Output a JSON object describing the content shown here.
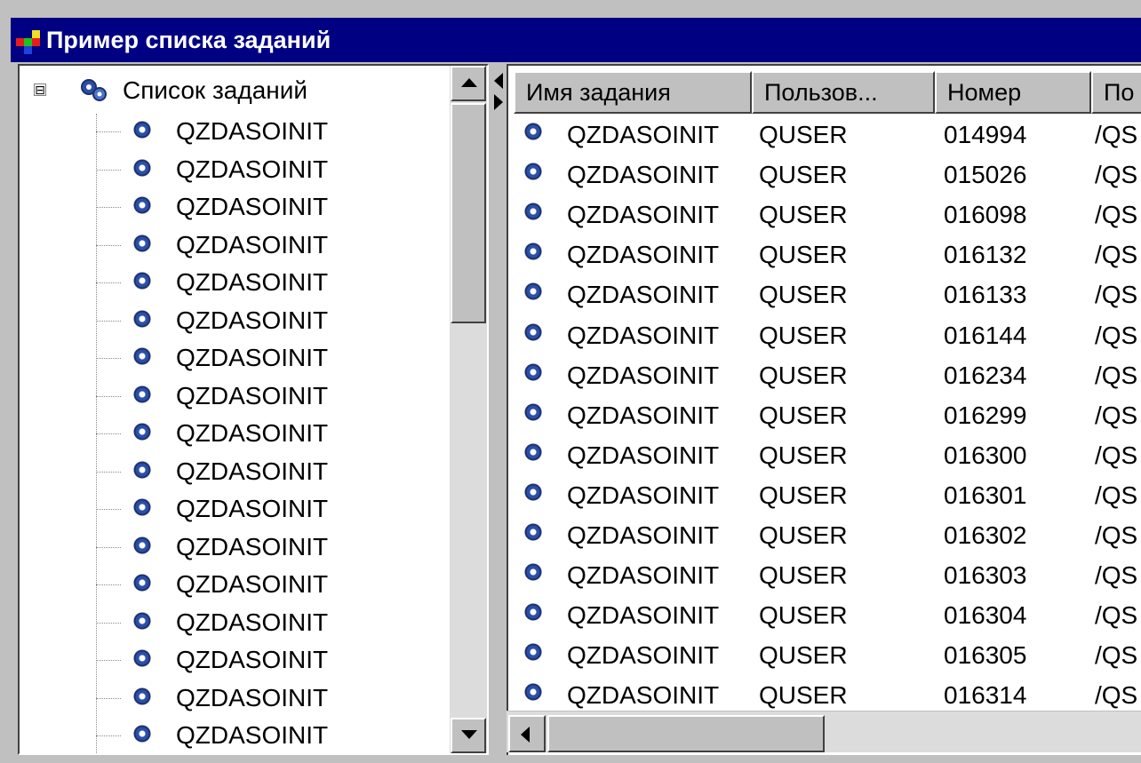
{
  "window": {
    "title": "Пример списка заданий",
    "colors": {
      "titlebar": "#000082",
      "face": "#c0c0c0",
      "pane": "#ffffff",
      "icon_gear": "#2b4fa8"
    }
  },
  "tree": {
    "root_label": "Список заданий",
    "root_icon": "gears-icon",
    "expander": "⊟",
    "items": [
      "QZDASOINIT",
      "QZDASOINIT",
      "QZDASOINIT",
      "QZDASOINIT",
      "QZDASOINIT",
      "QZDASOINIT",
      "QZDASOINIT",
      "QZDASOINIT",
      "QZDASOINIT",
      "QZDASOINIT",
      "QZDASOINIT",
      "QZDASOINIT",
      "QZDASOINIT",
      "QZDASOINIT",
      "QZDASOINIT",
      "QZDASOINIT",
      "QZDASOINIT"
    ]
  },
  "table": {
    "headers": [
      "Имя задания",
      "Пользов...",
      "Номер",
      "По"
    ],
    "rows": [
      [
        "QZDASOINIT",
        "QUSER",
        "014994",
        "/QS"
      ],
      [
        "QZDASOINIT",
        "QUSER",
        "015026",
        "/QS"
      ],
      [
        "QZDASOINIT",
        "QUSER",
        "016098",
        "/QS"
      ],
      [
        "QZDASOINIT",
        "QUSER",
        "016132",
        "/QS"
      ],
      [
        "QZDASOINIT",
        "QUSER",
        "016133",
        "/QS"
      ],
      [
        "QZDASOINIT",
        "QUSER",
        "016144",
        "/QS"
      ],
      [
        "QZDASOINIT",
        "QUSER",
        "016234",
        "/QS"
      ],
      [
        "QZDASOINIT",
        "QUSER",
        "016299",
        "/QS"
      ],
      [
        "QZDASOINIT",
        "QUSER",
        "016300",
        "/QS"
      ],
      [
        "QZDASOINIT",
        "QUSER",
        "016301",
        "/QS"
      ],
      [
        "QZDASOINIT",
        "QUSER",
        "016302",
        "/QS"
      ],
      [
        "QZDASOINIT",
        "QUSER",
        "016303",
        "/QS"
      ],
      [
        "QZDASOINIT",
        "QUSER",
        "016304",
        "/QS"
      ],
      [
        "QZDASOINIT",
        "QUSER",
        "016305",
        "/QS"
      ],
      [
        "QZDASOINIT",
        "QUSER",
        "016314",
        "/QS"
      ]
    ]
  }
}
